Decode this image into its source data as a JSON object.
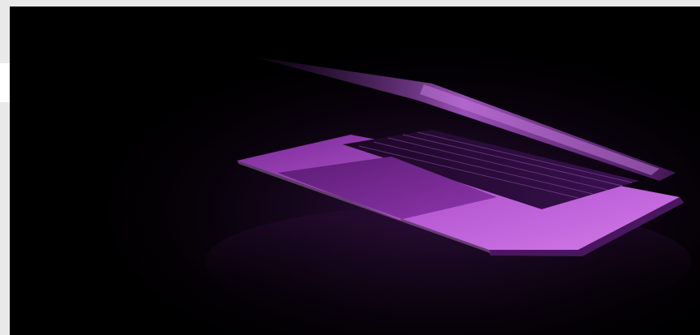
{
  "page": {
    "background_color": "#e9e9e9",
    "band_color": "#ffffff"
  },
  "hero": {
    "subject": "laptop-photo",
    "background_color": "#000000",
    "accent_color": "#b14fd0"
  }
}
